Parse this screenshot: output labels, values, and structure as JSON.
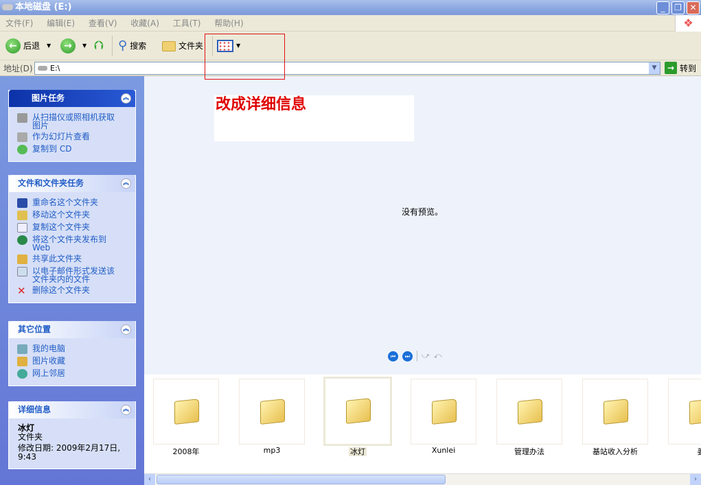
{
  "window": {
    "title": "本地磁盘 (E:)",
    "min": "_",
    "restore": "❐",
    "close": "✕"
  },
  "menu": [
    "文件(F)",
    "编辑(E)",
    "查看(V)",
    "收藏(A)",
    "工具(T)",
    "帮助(H)"
  ],
  "toolbar": {
    "back": "后退",
    "search": "搜索",
    "folders": "文件夹"
  },
  "address": {
    "label": "地址(D)",
    "value": "E:\\",
    "go": "转到"
  },
  "panels": {
    "picture_tasks": {
      "title": "图片任务",
      "items": [
        "从扫描仪或照相机获取图片",
        "作为幻灯片查看",
        "复制到 CD"
      ]
    },
    "file_tasks": {
      "title": "文件和文件夹任务",
      "items": [
        "重命名这个文件夹",
        "移动这个文件夹",
        "复制这个文件夹",
        "将这个文件夹发布到 Web",
        "共享此文件夹",
        "以电子邮件形式发送该文件夹内的文件",
        "删除这个文件夹"
      ]
    },
    "other_places": {
      "title": "其它位置",
      "items": [
        "我的电脑",
        "图片收藏",
        "网上邻居"
      ]
    },
    "details": {
      "title": "详细信息",
      "name": "冰灯",
      "type": "文件夹",
      "modified": "修改日期: 2009年2月17日, 9:43"
    }
  },
  "annotation": "改成详细信息",
  "preview": {
    "empty": "没有预览。"
  },
  "folders": [
    "2008年",
    "mp3",
    "冰灯",
    "Xunlei",
    "管理办法",
    "基站收入分析",
    "姜"
  ],
  "selected_folder": "冰灯"
}
